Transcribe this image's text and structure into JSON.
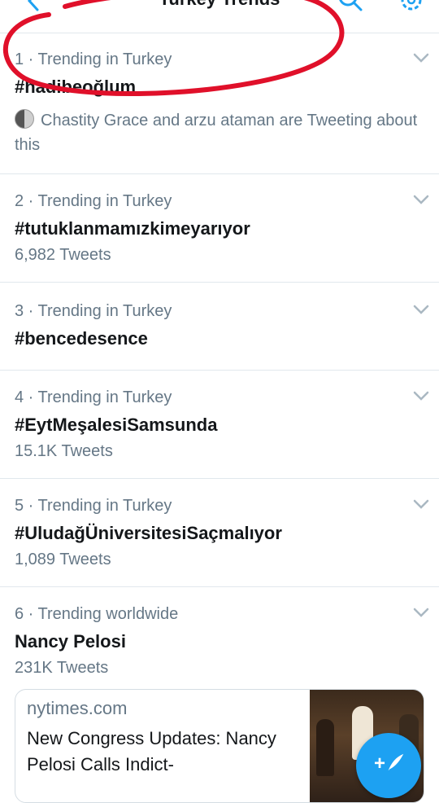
{
  "header": {
    "title": "Turkey Trends"
  },
  "trends": [
    {
      "rank_label": "1 · Trending in Turkey",
      "name": "#hadibeoğlum",
      "context": "Chastity Grace and arzu ataman are Tweeting about this"
    },
    {
      "rank_label": "2 · Trending in Turkey",
      "name": "#tutuklanmamızkimeyarıyor",
      "count": "6,982 Tweets"
    },
    {
      "rank_label": "3 · Trending in Turkey",
      "name": "#bencedesence"
    },
    {
      "rank_label": "4 · Trending in Turkey",
      "name": "#EytMeşalesiSamsunda",
      "count": "15.1K Tweets"
    },
    {
      "rank_label": "5 · Trending in Turkey",
      "name": "#UludağÜniversitesiSaçmalıyor",
      "count": "1,089 Tweets"
    },
    {
      "rank_label": "6 · Trending worldwide",
      "name": "Nancy Pelosi",
      "count": "231K Tweets"
    }
  ],
  "card": {
    "domain": "nytimes.com",
    "headline": "New Congress Updates: Nancy Pelosi Calls Indict-"
  },
  "fab": {
    "label": "+",
    "icon": "compose-tweet-icon"
  },
  "colors": {
    "accent": "#1da1f2",
    "annotation": "#e0102a",
    "secondary_text": "#657786"
  }
}
